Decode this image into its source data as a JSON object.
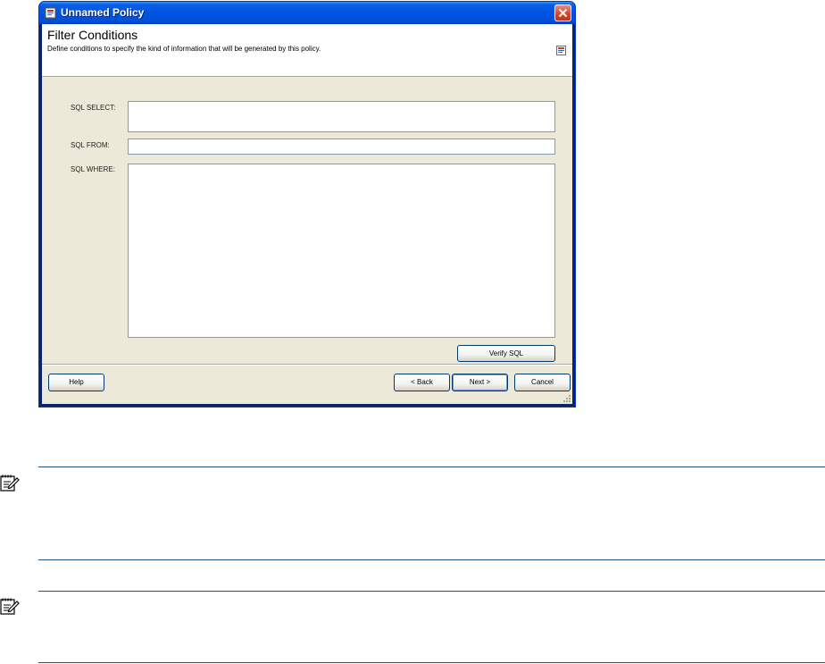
{
  "window": {
    "title": "Unnamed Policy",
    "header_title": "Filter Conditions",
    "header_description": "Define conditions to specify the kind of information that will be generated by this policy."
  },
  "fields": {
    "select": {
      "label": "SQL SELECT:",
      "value": ""
    },
    "from": {
      "label": "SQL FROM:",
      "value": ""
    },
    "where": {
      "label": "SQL WHERE:",
      "value": ""
    }
  },
  "buttons": {
    "verify": "Verify SQL",
    "help": "Help",
    "back": "< Back",
    "next": "Next >",
    "cancel": "Cancel"
  },
  "icons": {
    "title": "policy-icon",
    "close": "close-icon",
    "header": "policy-icon",
    "note": "note-icon"
  },
  "colors": {
    "titlebar": "#0054e3",
    "dialog_bg": "#ece9d8",
    "close": "#d1432a",
    "note_rule": "#1f4e79"
  }
}
